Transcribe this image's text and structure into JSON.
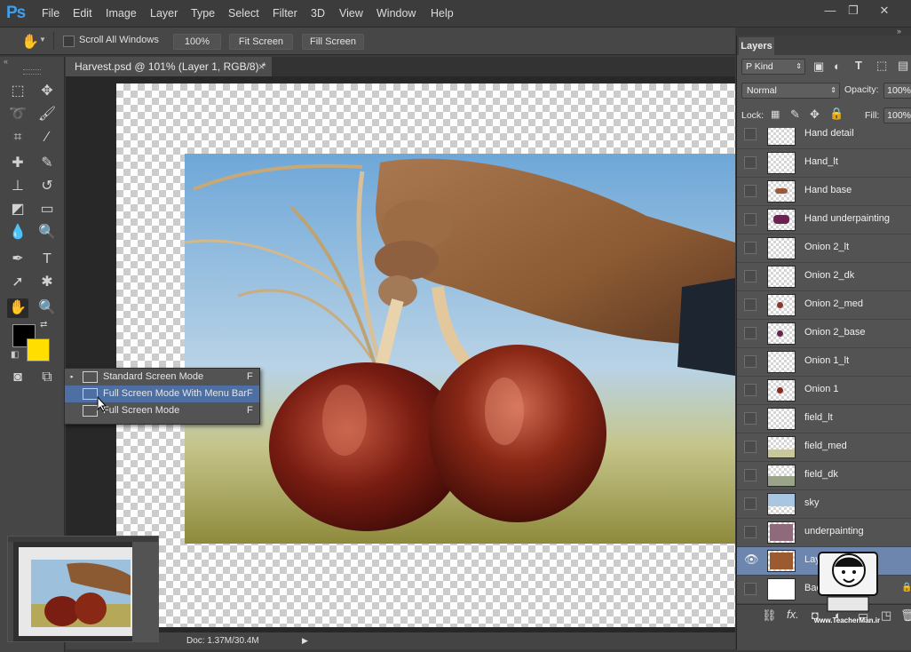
{
  "app": {
    "logo": "Ps"
  },
  "menu": [
    "File",
    "Edit",
    "Image",
    "Layer",
    "Type",
    "Select",
    "Filter",
    "3D",
    "View",
    "Window",
    "Help"
  ],
  "window_controls": {
    "minimize": "—",
    "restore": "❐",
    "close": "✕"
  },
  "options_bar": {
    "scroll_all_windows": "Scroll All Windows",
    "zoom_100": "100%",
    "fit_screen": "Fit Screen",
    "fill_screen": "Fill Screen"
  },
  "document": {
    "tab_title": "Harvest.psd @ 101% (Layer 1, RGB/8) *",
    "close": "×"
  },
  "status": {
    "doc": "Doc: 1.37M/30.4M",
    "arrow": "▶"
  },
  "screen_mode_menu": [
    {
      "label": "Standard Screen Mode",
      "key": "F",
      "bullet": "▪"
    },
    {
      "label": "Full Screen Mode With Menu Bar",
      "key": "F",
      "bullet": ""
    },
    {
      "label": "Full Screen Mode",
      "key": "F",
      "bullet": ""
    }
  ],
  "colors": {
    "foreground": "#000000",
    "background": "#ffde00",
    "selection": "#6c86ad",
    "accent": "#3d9ff0"
  },
  "layers_panel": {
    "tab": "Layers",
    "filter_kind": "Ρ Kind",
    "blend_mode": "Normal",
    "opacity_label": "Opacity:",
    "opacity_value": "100%",
    "lock_label": "Lock:",
    "fill_label": "Fill:",
    "fill_value": "100%",
    "layers": [
      {
        "name": "Hand detail",
        "visible": false
      },
      {
        "name": "Hand_lt",
        "visible": false
      },
      {
        "name": "Hand base",
        "visible": false
      },
      {
        "name": "Hand underpainting",
        "visible": false
      },
      {
        "name": "Onion 2_lt",
        "visible": false
      },
      {
        "name": "Onion 2_dk",
        "visible": false
      },
      {
        "name": "Onion 2_med",
        "visible": false
      },
      {
        "name": "Onion 2_base",
        "visible": false
      },
      {
        "name": "Onion 1_lt",
        "visible": false
      },
      {
        "name": "Onion 1",
        "visible": false
      },
      {
        "name": "field_lt",
        "visible": false
      },
      {
        "name": "field_med",
        "visible": false
      },
      {
        "name": "field_dk",
        "visible": false
      },
      {
        "name": "sky",
        "visible": false
      },
      {
        "name": "underpainting",
        "visible": false
      },
      {
        "name": "Layer 1",
        "visible": true,
        "selected": true
      },
      {
        "name": "Background",
        "visible": false
      }
    ],
    "footer_icons": [
      "link-icon",
      "fx-icon",
      "mask-icon",
      "adjustment-icon",
      "group-icon",
      "new-layer-icon",
      "trash-icon"
    ]
  },
  "watermark": {
    "text": "www.TeacherMan.ir"
  }
}
